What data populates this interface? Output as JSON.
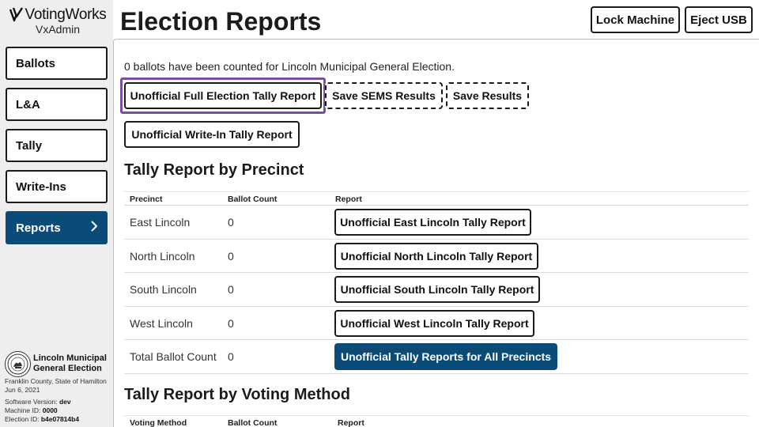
{
  "brand": {
    "name": "VotingWorks",
    "product": "VxAdmin"
  },
  "nav": {
    "items": [
      {
        "label": "Ballots"
      },
      {
        "label": "L&A"
      },
      {
        "label": "Tally"
      },
      {
        "label": "Write-Ins"
      },
      {
        "label": "Reports",
        "active": true
      }
    ]
  },
  "election": {
    "title": "Lincoln Municipal General Election",
    "location": "Franklin County, State of Hamilton",
    "date": "Jun 6, 2021",
    "software_version_label": "Software Version:",
    "software_version": "dev",
    "machine_id_label": "Machine ID:",
    "machine_id": "0000",
    "election_id_label": "Election ID:",
    "election_id": "b4e07814b4"
  },
  "header": {
    "title": "Election Reports",
    "lock_label": "Lock Machine",
    "eject_label": "Eject USB"
  },
  "summary": {
    "count": "0 ballots",
    "middle": " have been counted for ",
    "election_name": "Lincoln Municipal General Election",
    "end": "."
  },
  "actions": {
    "full_report": "Unofficial Full Election Tally Report",
    "save_sems": "Save SEMS Results",
    "save_results": "Save Results",
    "write_in_report": "Unofficial Write-In Tally Report"
  },
  "precinct_section": {
    "title": "Tally Report by Precinct",
    "headers": {
      "precinct": "Precinct",
      "ballot_count": "Ballot Count",
      "report": "Report"
    },
    "rows": [
      {
        "precinct": "East Lincoln",
        "count": "0",
        "report": "Unofficial East Lincoln Tally Report"
      },
      {
        "precinct": "North Lincoln",
        "count": "0",
        "report": "Unofficial North Lincoln Tally Report"
      },
      {
        "precinct": "South Lincoln",
        "count": "0",
        "report": "Unofficial South Lincoln Tally Report"
      },
      {
        "precinct": "West Lincoln",
        "count": "0",
        "report": "Unofficial West Lincoln Tally Report"
      }
    ],
    "total": {
      "label": "Total Ballot Count",
      "count": "0",
      "report": "Unofficial Tally Reports for All Precincts"
    }
  },
  "voting_method_section": {
    "title": "Tally Report by Voting Method",
    "headers": {
      "voting_method": "Voting Method",
      "ballot_count": "Ballot Count",
      "report": "Report"
    }
  },
  "colors": {
    "primary": "#0a4b78",
    "focus": "#7b4ea6",
    "sidebar_bg": "#eeeeee"
  },
  "icons": {
    "nav_chevron": "chevron-right-icon",
    "brand_mark": "votingworks-check-icon",
    "seal": "state-seal-icon"
  }
}
